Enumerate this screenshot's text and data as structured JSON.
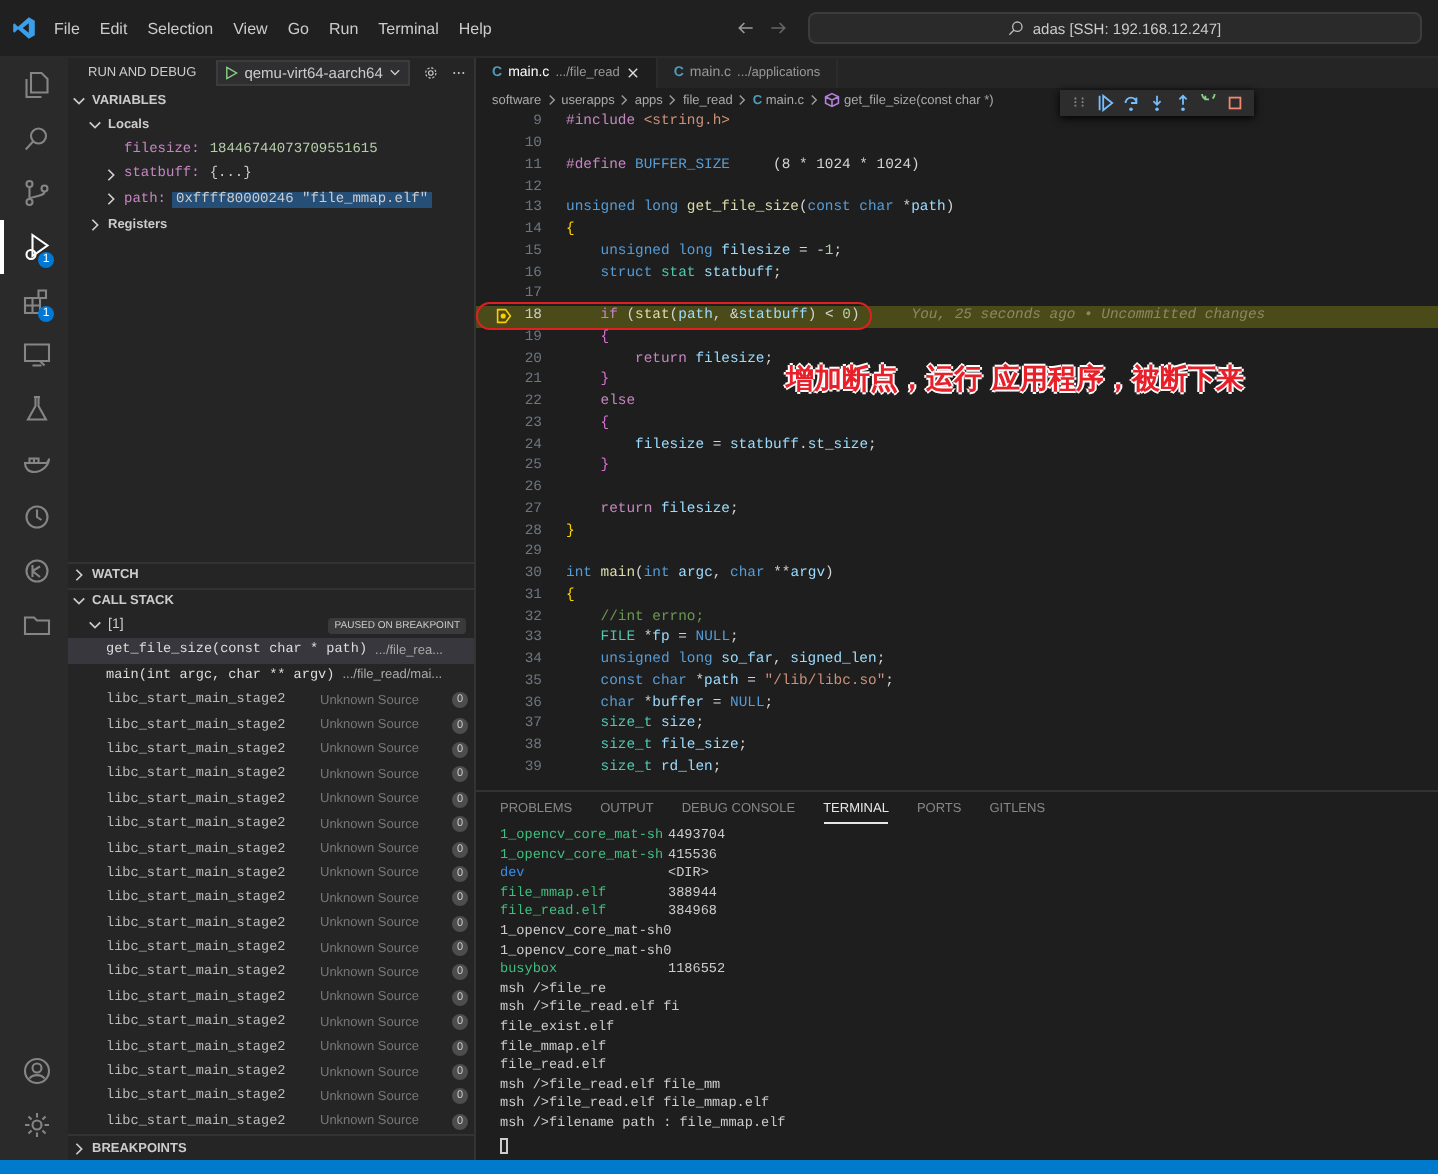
{
  "title_bar": {
    "menu": [
      "File",
      "Edit",
      "Selection",
      "View",
      "Go",
      "Run",
      "Terminal",
      "Help"
    ],
    "command_center": "adas [SSH: 192.168.12.247]"
  },
  "activity_bar": {
    "items": [
      {
        "kind": "explorer",
        "selected": false
      },
      {
        "kind": "search",
        "selected": false
      },
      {
        "kind": "source-control",
        "selected": false
      },
      {
        "kind": "run-debug",
        "selected": true,
        "badge": "1"
      },
      {
        "kind": "extensions",
        "selected": false,
        "badge": "1"
      },
      {
        "kind": "remote",
        "selected": false
      },
      {
        "kind": "testing",
        "selected": false
      },
      {
        "kind": "docker",
        "selected": false
      },
      {
        "kind": "timeline",
        "selected": false
      },
      {
        "kind": "gitlens",
        "selected": false
      },
      {
        "kind": "folder",
        "selected": false
      }
    ],
    "bottom": [
      {
        "kind": "account",
        "selected": false
      },
      {
        "kind": "settings",
        "selected": false
      }
    ]
  },
  "sidebar": {
    "title": "RUN AND DEBUG",
    "configuration": "qemu-virt64-aarch64",
    "variables": {
      "title": "VARIABLES",
      "expanded": true,
      "scopes": [
        {
          "name": "Locals",
          "expanded": true,
          "children": [
            {
              "name": "filesize:",
              "value": "18446744073709551615",
              "kind": "number",
              "expandable": false,
              "selected": false
            },
            {
              "name": "statbuff:",
              "value": "{...}",
              "kind": "object",
              "expandable": true,
              "selected": false
            },
            {
              "name": "path:",
              "value": "0xffff80000246 \"file_mmap.elf\"",
              "kind": "pointer",
              "expandable": true,
              "selected": true
            }
          ]
        },
        {
          "name": "Registers",
          "expanded": false
        }
      ]
    },
    "watch": {
      "title": "WATCH",
      "expanded": false
    },
    "call_stack": {
      "title": "CALL STACK",
      "expanded": true,
      "thread": "[1]",
      "status": "PAUSED ON BREAKPOINT",
      "frames": [
        {
          "kind": "user",
          "function": "get_file_size(const char * path)",
          "source": ".../file_rea...",
          "selected": true
        },
        {
          "kind": "user",
          "function": "main(int argc, char ** argv)",
          "source": ".../file_read/mai...",
          "selected": false
        },
        {
          "kind": "unknown",
          "function": "libc_start_main_stage2",
          "source": "Unknown Source",
          "badge": "0",
          "selected": false
        },
        {
          "kind": "unknown",
          "function": "libc_start_main_stage2",
          "source": "Unknown Source",
          "badge": "0",
          "selected": false
        },
        {
          "kind": "unknown",
          "function": "libc_start_main_stage2",
          "source": "Unknown Source",
          "badge": "0",
          "selected": false
        },
        {
          "kind": "unknown",
          "function": "libc_start_main_stage2",
          "source": "Unknown Source",
          "badge": "0",
          "selected": false
        },
        {
          "kind": "unknown",
          "function": "libc_start_main_stage2",
          "source": "Unknown Source",
          "badge": "0",
          "selected": false
        },
        {
          "kind": "unknown",
          "function": "libc_start_main_stage2",
          "source": "Unknown Source",
          "badge": "0",
          "selected": false
        },
        {
          "kind": "unknown",
          "function": "libc_start_main_stage2",
          "source": "Unknown Source",
          "badge": "0",
          "selected": false
        },
        {
          "kind": "unknown",
          "function": "libc_start_main_stage2",
          "source": "Unknown Source",
          "badge": "0",
          "selected": false
        },
        {
          "kind": "unknown",
          "function": "libc_start_main_stage2",
          "source": "Unknown Source",
          "badge": "0",
          "selected": false
        },
        {
          "kind": "unknown",
          "function": "libc_start_main_stage2",
          "source": "Unknown Source",
          "badge": "0",
          "selected": false
        },
        {
          "kind": "unknown",
          "function": "libc_start_main_stage2",
          "source": "Unknown Source",
          "badge": "0",
          "selected": false
        },
        {
          "kind": "unknown",
          "function": "libc_start_main_stage2",
          "source": "Unknown Source",
          "badge": "0",
          "selected": false
        },
        {
          "kind": "unknown",
          "function": "libc_start_main_stage2",
          "source": "Unknown Source",
          "badge": "0",
          "selected": false
        },
        {
          "kind": "unknown",
          "function": "libc_start_main_stage2",
          "source": "Unknown Source",
          "badge": "0",
          "selected": false
        },
        {
          "kind": "unknown",
          "function": "libc_start_main_stage2",
          "source": "Unknown Source",
          "badge": "0",
          "selected": false
        },
        {
          "kind": "unknown",
          "function": "libc_start_main_stage2",
          "source": "Unknown Source",
          "badge": "0",
          "selected": false
        },
        {
          "kind": "unknown",
          "function": "libc_start_main_stage2",
          "source": "Unknown Source",
          "badge": "0",
          "selected": false
        },
        {
          "kind": "unknown",
          "function": "libc_start_main_stage2",
          "source": "Unknown Source",
          "badge": "0",
          "selected": false
        }
      ]
    },
    "breakpoints": {
      "title": "BREAKPOINTS",
      "expanded": false
    }
  },
  "editor": {
    "tabs": [
      {
        "icon": "C",
        "label": "main.c",
        "detail": ".../file_read",
        "selected": true
      },
      {
        "icon": "C",
        "label": "main.c",
        "detail": ".../applications",
        "selected": false
      }
    ],
    "breadcrumb": [
      {
        "kind": "folder",
        "text": "software"
      },
      {
        "kind": "folder",
        "text": "userapps"
      },
      {
        "kind": "folder",
        "text": "apps"
      },
      {
        "kind": "folder",
        "text": "file_read"
      },
      {
        "kind": "file",
        "icon": "C",
        "text": "main.c"
      },
      {
        "kind": "symbol",
        "text": "get_file_size(const char *)"
      }
    ],
    "lines": [
      {
        "number": "9",
        "current": false,
        "tokens": [
          {
            "kind": "pp",
            "text": "#include"
          },
          {
            "kind": "str",
            "text": " <string.h>"
          }
        ]
      },
      {
        "number": "10",
        "current": false
      },
      {
        "number": "11",
        "current": false,
        "tokens": [
          {
            "kind": "pp",
            "text": "#define"
          },
          {
            "kind": "macro",
            "text": " BUFFER_SIZE"
          },
          {
            "kind": "punct",
            "text": "     (8 * 1024 * 1024)"
          }
        ]
      },
      {
        "number": "12",
        "current": false
      },
      {
        "number": "13",
        "current": false,
        "tokens": [
          {
            "kind": "kw",
            "text": "unsigned long "
          },
          {
            "kind": "fn",
            "text": "get_file_size"
          },
          {
            "kind": "punct",
            "text": "("
          },
          {
            "kind": "kw",
            "text": "const char "
          },
          {
            "kind": "punct",
            "text": "*"
          },
          {
            "kind": "var",
            "text": "path"
          },
          {
            "kind": "punct",
            "text": ")"
          }
        ]
      },
      {
        "number": "14",
        "current": false,
        "tokens": [
          {
            "kind": "brace",
            "text": "{"
          }
        ]
      },
      {
        "number": "15",
        "current": false,
        "tokens": [
          {
            "kind": "kw",
            "text": "    unsigned long "
          },
          {
            "kind": "var",
            "text": "filesize"
          },
          {
            "kind": "punct",
            "text": " = -"
          },
          {
            "kind": "num",
            "text": "1"
          },
          {
            "kind": "punct",
            "text": ";"
          }
        ]
      },
      {
        "number": "16",
        "current": false,
        "tokens": [
          {
            "kind": "kw",
            "text": "    struct "
          },
          {
            "kind": "type",
            "text": "stat "
          },
          {
            "kind": "var",
            "text": "statbuff"
          },
          {
            "kind": "punct",
            "text": ";"
          }
        ]
      },
      {
        "number": "17",
        "current": false
      },
      {
        "number": "18",
        "current": true,
        "blame": "You, 25 seconds ago • Uncommitted changes",
        "tokens": [
          {
            "kind": "ctrl",
            "text": "    if"
          },
          {
            "kind": "punct",
            "text": " ("
          },
          {
            "kind": "fn",
            "text": "stat"
          },
          {
            "kind": "punct",
            "text": "("
          },
          {
            "kind": "var",
            "text": "path"
          },
          {
            "kind": "punct",
            "text": ", &"
          },
          {
            "kind": "var",
            "text": "statbuff"
          },
          {
            "kind": "punct",
            "text": ") < "
          },
          {
            "kind": "num",
            "text": "0"
          },
          {
            "kind": "punct",
            "text": ")"
          }
        ]
      },
      {
        "number": "19",
        "current": false,
        "tokens": [
          {
            "kind": "brace2",
            "text": "    {"
          }
        ]
      },
      {
        "number": "20",
        "current": false,
        "tokens": [
          {
            "kind": "ctrl",
            "text": "        return "
          },
          {
            "kind": "var",
            "text": "filesize"
          },
          {
            "kind": "punct",
            "text": ";"
          }
        ]
      },
      {
        "number": "21",
        "current": false,
        "tokens": [
          {
            "kind": "brace2",
            "text": "    }"
          }
        ]
      },
      {
        "number": "22",
        "current": false,
        "tokens": [
          {
            "kind": "ctrl",
            "text": "    else"
          }
        ]
      },
      {
        "number": "23",
        "current": false,
        "tokens": [
          {
            "kind": "brace2",
            "text": "    {"
          }
        ]
      },
      {
        "number": "24",
        "current": false,
        "tokens": [
          {
            "kind": "var",
            "text": "        filesize"
          },
          {
            "kind": "punct",
            "text": " = "
          },
          {
            "kind": "var",
            "text": "statbuff"
          },
          {
            "kind": "punct",
            "text": "."
          },
          {
            "kind": "var",
            "text": "st_size"
          },
          {
            "kind": "punct",
            "text": ";"
          }
        ]
      },
      {
        "number": "25",
        "current": false,
        "tokens": [
          {
            "kind": "brace2",
            "text": "    }"
          }
        ]
      },
      {
        "number": "26",
        "current": false
      },
      {
        "number": "27",
        "current": false,
        "tokens": [
          {
            "kind": "ctrl",
            "text": "    return "
          },
          {
            "kind": "var",
            "text": "filesize"
          },
          {
            "kind": "punct",
            "text": ";"
          }
        ]
      },
      {
        "number": "28",
        "current": false,
        "tokens": [
          {
            "kind": "brace",
            "text": "}"
          }
        ]
      },
      {
        "number": "29",
        "current": false
      },
      {
        "number": "30",
        "current": false,
        "tokens": [
          {
            "kind": "kw",
            "text": "int "
          },
          {
            "kind": "fn",
            "text": "main"
          },
          {
            "kind": "punct",
            "text": "("
          },
          {
            "kind": "kw",
            "text": "int "
          },
          {
            "kind": "var",
            "text": "argc"
          },
          {
            "kind": "punct",
            "text": ", "
          },
          {
            "kind": "kw",
            "text": "char "
          },
          {
            "kind": "punct",
            "text": "**"
          },
          {
            "kind": "var",
            "text": "argv"
          },
          {
            "kind": "punct",
            "text": ")"
          }
        ]
      },
      {
        "number": "31",
        "current": false,
        "tokens": [
          {
            "kind": "brace",
            "text": "{"
          }
        ]
      },
      {
        "number": "32",
        "current": false,
        "tokens": [
          {
            "kind": "comment",
            "text": "    //int errno;"
          }
        ]
      },
      {
        "number": "33",
        "current": false,
        "tokens": [
          {
            "kind": "type",
            "text": "    FILE "
          },
          {
            "kind": "punct",
            "text": "*"
          },
          {
            "kind": "var",
            "text": "fp"
          },
          {
            "kind": "punct",
            "text": " = "
          },
          {
            "kind": "macro",
            "text": "NULL"
          },
          {
            "kind": "punct",
            "text": ";"
          }
        ]
      },
      {
        "number": "34",
        "current": false,
        "tokens": [
          {
            "kind": "kw",
            "text": "    unsigned long "
          },
          {
            "kind": "var",
            "text": "so_far"
          },
          {
            "kind": "punct",
            "text": ", "
          },
          {
            "kind": "var",
            "text": "signed_len"
          },
          {
            "kind": "punct",
            "text": ";"
          }
        ]
      },
      {
        "number": "35",
        "current": false,
        "tokens": [
          {
            "kind": "kw",
            "text": "    const char "
          },
          {
            "kind": "punct",
            "text": "*"
          },
          {
            "kind": "var",
            "text": "path"
          },
          {
            "kind": "punct",
            "text": " = "
          },
          {
            "kind": "str",
            "text": "\"/lib/libc.so\""
          },
          {
            "kind": "punct",
            "text": ";"
          }
        ]
      },
      {
        "number": "36",
        "current": false,
        "tokens": [
          {
            "kind": "kw",
            "text": "    char "
          },
          {
            "kind": "punct",
            "text": "*"
          },
          {
            "kind": "var",
            "text": "buffer"
          },
          {
            "kind": "punct",
            "text": " = "
          },
          {
            "kind": "macro",
            "text": "NULL"
          },
          {
            "kind": "punct",
            "text": ";"
          }
        ]
      },
      {
        "number": "37",
        "current": false,
        "tokens": [
          {
            "kind": "type",
            "text": "    size_t "
          },
          {
            "kind": "var",
            "text": "size"
          },
          {
            "kind": "punct",
            "text": ";"
          }
        ]
      },
      {
        "number": "38",
        "current": false,
        "tokens": [
          {
            "kind": "type",
            "text": "    size_t "
          },
          {
            "kind": "var",
            "text": "file_size"
          },
          {
            "kind": "punct",
            "text": ";"
          }
        ]
      },
      {
        "number": "39",
        "current": false,
        "tokens": [
          {
            "kind": "type",
            "text": "    size_t "
          },
          {
            "kind": "var",
            "text": "rd_len"
          },
          {
            "kind": "punct",
            "text": ";"
          }
        ]
      }
    ],
    "debug_toolbar": [
      {
        "kind": "grip"
      },
      {
        "kind": "continue"
      },
      {
        "kind": "step-over"
      },
      {
        "kind": "step-into"
      },
      {
        "kind": "step-out"
      },
      {
        "kind": "restart"
      },
      {
        "kind": "stop"
      }
    ],
    "annotation": "增加断点，运行 应用程序，被断下来"
  },
  "panel": {
    "tabs": [
      {
        "label": "PROBLEMS",
        "selected": false
      },
      {
        "label": "OUTPUT",
        "selected": false
      },
      {
        "label": "DEBUG CONSOLE",
        "selected": false
      },
      {
        "label": "TERMINAL",
        "selected": true
      },
      {
        "label": "PORTS",
        "selected": false
      },
      {
        "label": "GITLENS",
        "selected": false
      }
    ],
    "terminal": {
      "cursor": true,
      "lines": [
        {
          "kind": "entry",
          "name": "1_opencv_core_mat-sh",
          "size": "4493704",
          "color": "#3fbf7f"
        },
        {
          "kind": "entry",
          "name": "1_opencv_core_mat-sh",
          "size": "415536",
          "color": "#3fbf7f"
        },
        {
          "kind": "entry",
          "name": "dev",
          "size": "<DIR>",
          "color": "#3b8eea"
        },
        {
          "kind": "entry",
          "name": "file_mmap.elf",
          "size": "388944",
          "color": "#3fbf7f"
        },
        {
          "kind": "entry",
          "name": "file_read.elf",
          "size": "384968",
          "color": "#3fbf7f"
        },
        {
          "kind": "text",
          "text": "1_opencv_core_mat-sh0"
        },
        {
          "kind": "text",
          "text": "1_opencv_core_mat-sh0"
        },
        {
          "kind": "entry",
          "name": "busybox",
          "size": "1186552",
          "color": "#3fbf7f"
        },
        {
          "kind": "text",
          "text": "msh />file_re"
        },
        {
          "kind": "text",
          "text": "msh />file_read.elf fi"
        },
        {
          "kind": "text",
          "text": "file_exist.elf"
        },
        {
          "kind": "text",
          "text": "file_mmap.elf"
        },
        {
          "kind": "text",
          "text": "file_read.elf"
        },
        {
          "kind": "text",
          "text": "msh />file_read.elf file_mm"
        },
        {
          "kind": "text",
          "text": "msh />file_read.elf file_mmap.elf"
        },
        {
          "kind": "text",
          "text": "msh />filename path : file_mmap.elf"
        }
      ]
    }
  }
}
